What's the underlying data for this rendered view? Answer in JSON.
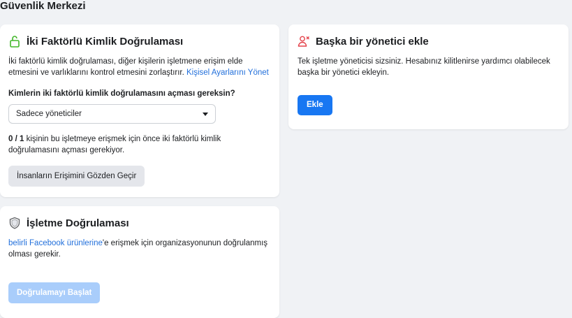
{
  "page": {
    "title": "Güvenlik Merkezi"
  },
  "two_factor": {
    "title": "İki Faktörlü Kimlik Doğrulaması",
    "description": "İki faktörlü kimlik doğrulaması, diğer kişilerin işletmene erişim elde etmesini ve varlıklarını kontrol etmesini zorlaştırır. ",
    "link": "Kişisel Ayarlarını Yönet",
    "question": "Kimlerin iki faktörlü kimlik doğrulamasını açması gereksin?",
    "select_value": "Sadece yöneticiler",
    "count": "0 / 1",
    "count_text": " kişinin bu işletmeye erişmek için önce iki faktörlü kimlik doğrulamasını açması gerekiyor.",
    "review_button": "İnsanların Erişimini Gözden Geçir"
  },
  "add_admin": {
    "title": "Başka bir yönetici ekle",
    "description": "Tek işletme yöneticisi sizsiniz. Hesabınız kilitlenirse yardımcı olabilecek başka bir yönetici ekleyin.",
    "add_button": "Ekle"
  },
  "business_verification": {
    "title": "İşletme Doğrulaması",
    "link": "belirli Facebook ürünlerine",
    "description": "'e erişmek için organizasyonunun doğrulanmış olması gerekir.",
    "start_button": "Doğrulamayı Başlat"
  },
  "colors": {
    "accent": "#1877f2",
    "link": "#216fdb",
    "alert": "#e4434b",
    "success": "#42b72a"
  }
}
